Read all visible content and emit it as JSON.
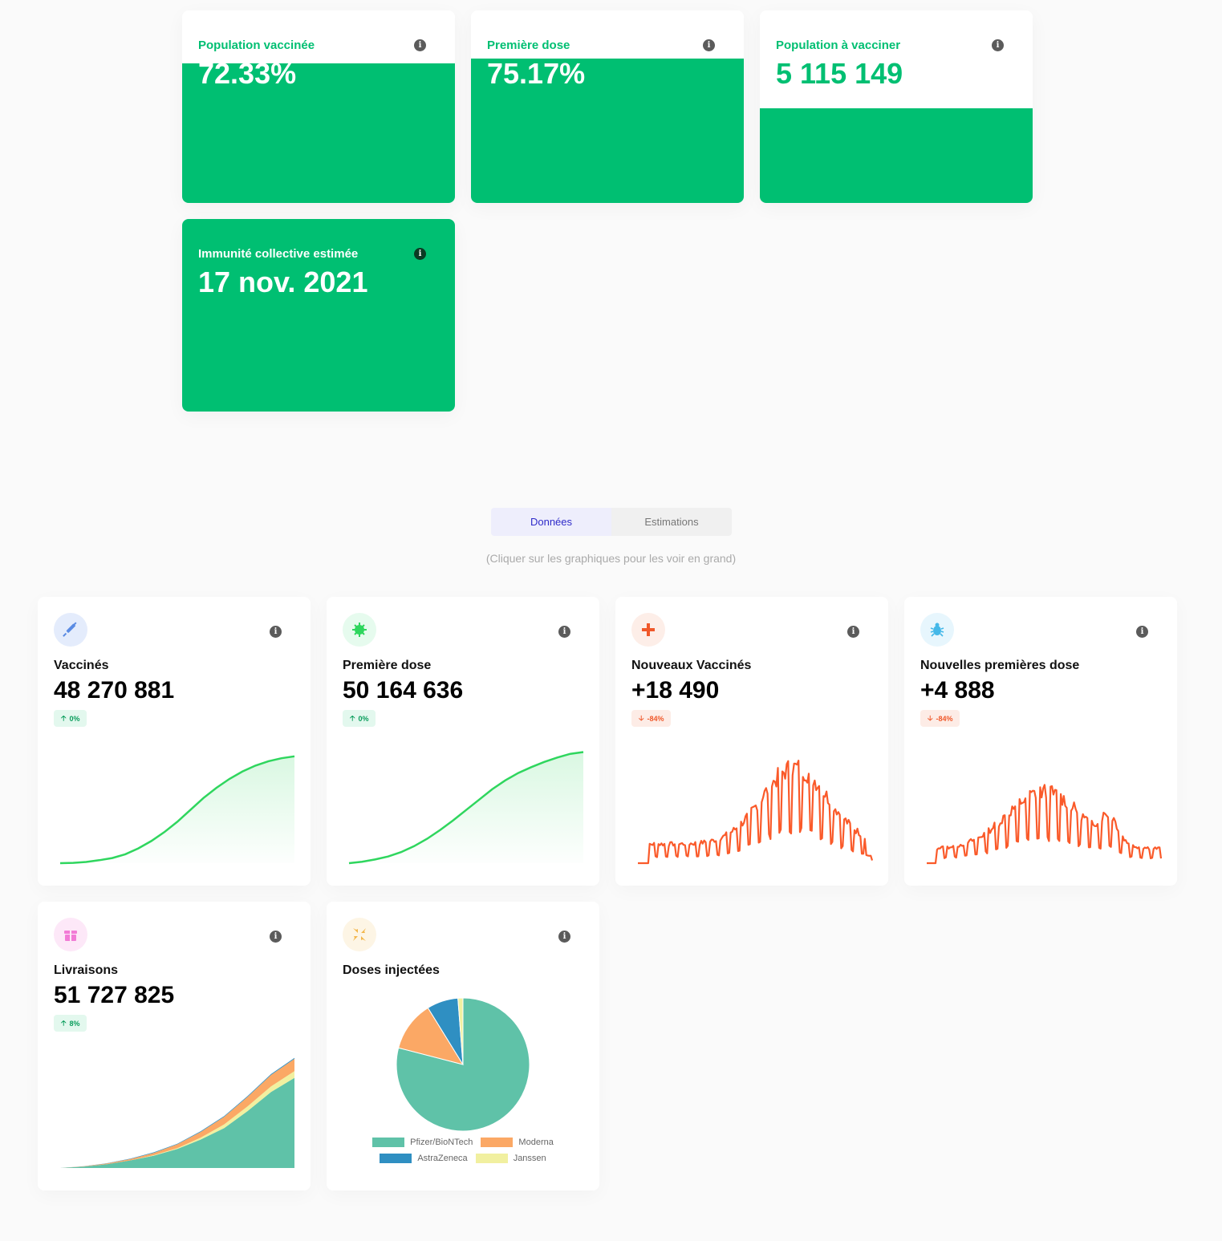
{
  "top_cards": [
    {
      "label": "Population vaccinée",
      "value": "72.33%",
      "fill_fraction": 0.7233
    },
    {
      "label": "Première dose",
      "value": "75.17%",
      "fill_fraction": 0.7517
    },
    {
      "label": "Population à vacciner",
      "value": "5 115 149",
      "fill_fraction": 0.49
    },
    {
      "label": "Immunité collective estimée",
      "value": "17 nov. 2021",
      "fill_fraction": 1.0
    }
  ],
  "tabs": [
    {
      "label": "Données",
      "active": true
    },
    {
      "label": "Estimations",
      "active": false
    }
  ],
  "hint": "(Cliquer sur les graphiques pour les voir en grand)",
  "colors": {
    "green": "#00bf72",
    "line_green": "#2fd65e",
    "line_orange": "#fa5a2a"
  },
  "cards": [
    {
      "title": "Vaccinés",
      "value": "48 270 881",
      "badge": "0%",
      "trend": "up",
      "icon": "syringe-icon",
      "icon_color": "#5a8be3",
      "icon_bg": "#e4ecfc"
    },
    {
      "title": "Première dose",
      "value": "50 164 636",
      "badge": "0%",
      "trend": "up",
      "icon": "virus-icon",
      "icon_color": "#2fd65e",
      "icon_bg": "#e6fbee"
    },
    {
      "title": "Nouveaux Vaccinés",
      "value": "+18 490",
      "badge": "-84%",
      "trend": "down",
      "icon": "plus-icon",
      "icon_color": "#f0582a",
      "icon_bg": "#fdeee8"
    },
    {
      "title": "Nouvelles premières dose",
      "value": "+4 888",
      "badge": "-84%",
      "trend": "down",
      "icon": "bug-icon",
      "icon_color": "#45b8e8",
      "icon_bg": "#e7f6fd"
    },
    {
      "title": "Livraisons",
      "value": "51 727 825",
      "badge": "8%",
      "trend": "up",
      "icon": "box-icon",
      "icon_color": "#f27bd6",
      "icon_bg": "#fde8f8"
    },
    {
      "title": "Doses injectées",
      "icon": "compress-icon",
      "icon_color": "#f3b64a",
      "icon_bg": "#fdf5e5"
    }
  ],
  "chart_data": [
    {
      "type": "area",
      "title": "Vaccinés",
      "trend": "cumulative",
      "color": "#2fd65e",
      "values": [
        0,
        0.2,
        0.8,
        2,
        3.5,
        6,
        10,
        15,
        21,
        28,
        36,
        44,
        51,
        57,
        62,
        66,
        69,
        71,
        72.3
      ]
    },
    {
      "type": "area",
      "title": "Première dose",
      "trend": "cumulative",
      "color": "#2fd65e",
      "values": [
        0,
        1,
        2.5,
        4.5,
        7.5,
        11.5,
        16.5,
        22.5,
        29,
        36,
        43,
        50,
        56,
        61,
        65,
        68.5,
        71.5,
        74,
        75.2
      ]
    },
    {
      "type": "line",
      "title": "Nouveaux Vaccinés",
      "color": "#fa5a2a"
    },
    {
      "type": "line",
      "title": "Nouvelles premières dose",
      "color": "#fa5a2a"
    },
    {
      "type": "area",
      "title": "Livraisons",
      "series": [
        {
          "name": "Pfizer/BioNTech",
          "color": "#5fc2a8",
          "values": [
            0,
            1.5,
            4,
            8,
            13,
            20,
            30,
            42,
            60,
            80,
            95
          ]
        },
        {
          "name": "Janssen",
          "color": "#f1f0a0",
          "values": [
            0,
            0,
            0,
            0,
            0.5,
            1,
            2,
            4,
            5,
            6,
            7
          ]
        },
        {
          "name": "Moderna",
          "color": "#fba865",
          "values": [
            0,
            0.3,
            0.8,
            1.5,
            2.5,
            4,
            6,
            8,
            10,
            12,
            13
          ]
        },
        {
          "name": "AstraZeneca",
          "color": "#2f8fc2",
          "values": [
            0,
            0.1,
            0.3,
            0.5,
            0.6,
            0.6,
            0.8,
            0.8,
            0.9,
            1,
            1
          ]
        }
      ]
    },
    {
      "type": "pie",
      "title": "Doses injectées",
      "labels": [
        "Pfizer/BioNTech",
        "Moderna",
        "AstraZeneca",
        "Janssen"
      ],
      "values": [
        78,
        12,
        7.5,
        1.2
      ],
      "colors": [
        "#5fc2a8",
        "#fba865",
        "#2f8fc2",
        "#f1f0a0"
      ]
    }
  ],
  "legend": {
    "row1": [
      "Pfizer/BioNTech",
      "Moderna"
    ],
    "row2": [
      "AstraZeneca",
      "Janssen"
    ]
  }
}
